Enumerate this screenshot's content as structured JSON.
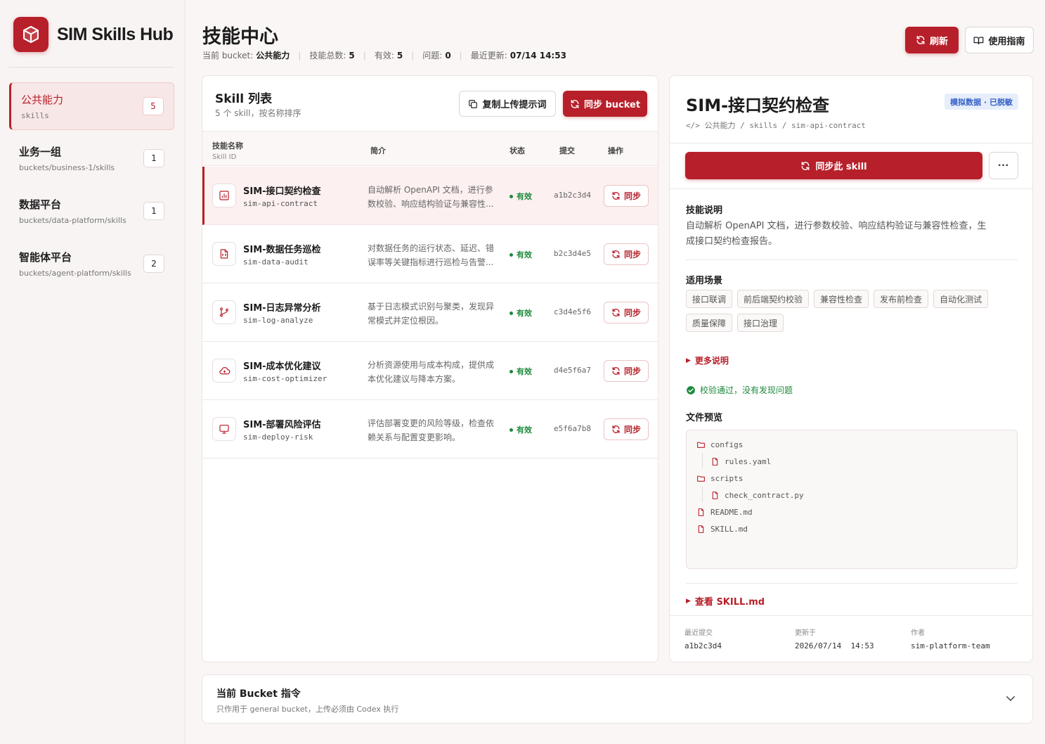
{
  "brand": {
    "name": "SIM Skills Hub"
  },
  "sidebar": {
    "buckets": [
      {
        "name": "公共能力",
        "path": "skills",
        "count": "5",
        "active": true
      },
      {
        "name": "业务一组",
        "path": "buckets/business-1/skills",
        "count": "1",
        "active": false
      },
      {
        "name": "数据平台",
        "path": "buckets/data-platform/skills",
        "count": "1",
        "active": false
      },
      {
        "name": "智能体平台",
        "path": "buckets/agent-platform/skills",
        "count": "2",
        "active": false
      }
    ]
  },
  "header": {
    "title": "技能中心",
    "stats": {
      "bucket_label": "当前 bucket:",
      "bucket_value": "公共能力",
      "total_label": "技能总数:",
      "total_value": "5",
      "valid_label": "有效:",
      "valid_value": "5",
      "issues_label": "问题:",
      "issues_value": "0",
      "updated_label": "最近更新:",
      "updated_value": "07/14 14:53"
    },
    "refresh_label": "刷新",
    "guide_label": "使用指南"
  },
  "list": {
    "title": "Skill 列表",
    "subtitle": "5 个 skill，按名称排序",
    "copy_label": "复制上传提示词",
    "sync_bucket_label": "同步 bucket",
    "columns": {
      "name": "技能名称",
      "name_sub": "Skill ID",
      "desc": "简介",
      "status": "状态",
      "commit": "提交",
      "action": "操作"
    },
    "rows": [
      {
        "name": "SIM-接口契约检查",
        "id": "sim-api-contract",
        "desc": "自动解析 OpenAPI 文档，进行参数校验、响应结构验证与兼容性...",
        "status": "有效",
        "commit": "a1b2c3d4",
        "sync": "同步",
        "icon": "chart-icon",
        "active": true
      },
      {
        "name": "SIM-数据任务巡检",
        "id": "sim-data-audit",
        "desc": "对数据任务的运行状态、延迟、错误率等关键指标进行巡检与告警...",
        "status": "有效",
        "commit": "b2c3d4e5",
        "sync": "同步",
        "icon": "file-code-icon",
        "active": false
      },
      {
        "name": "SIM-日志异常分析",
        "id": "sim-log-analyze",
        "desc": "基于日志模式识别与聚类，发现异常模式并定位根因。",
        "status": "有效",
        "commit": "c3d4e5f6",
        "sync": "同步",
        "icon": "git-branch-icon",
        "active": false
      },
      {
        "name": "SIM-成本优化建议",
        "id": "sim-cost-optimizer",
        "desc": "分析资源使用与成本构成，提供成本优化建议与降本方案。",
        "status": "有效",
        "commit": "d4e5f6a7",
        "sync": "同步",
        "icon": "cloud-icon",
        "active": false
      },
      {
        "name": "SIM-部署风险评估",
        "id": "sim-deploy-risk",
        "desc": "评估部署变更的风险等级，检查依赖关系与配置变更影响。",
        "status": "有效",
        "commit": "e5f6a7b8",
        "sync": "同步",
        "icon": "monitor-icon",
        "active": false
      }
    ]
  },
  "detail": {
    "title": "SIM-接口契约检查",
    "badge": "模拟数据 · 已脱敏",
    "breadcrumb": "公共能力 / skills / sim-api-contract",
    "sync_label": "同步此 skill",
    "more_label": "···",
    "desc_title": "技能说明",
    "desc": "自动解析 OpenAPI 文档，进行参数校验、响应结构验证与兼容性检查，生成接口契约检查报告。",
    "scenes_title": "适用场景",
    "tags": [
      "接口联调",
      "前后端契约校验",
      "兼容性检查",
      "发布前检查",
      "自动化测试",
      "质量保障",
      "接口治理"
    ],
    "more_desc_label": "更多说明",
    "valid_text": "校验通过，没有发现问题",
    "preview_title": "文件预览",
    "files": [
      "configs",
      "rules.yaml",
      "scripts",
      "check_contract.py",
      "README.md",
      "SKILL.md"
    ],
    "view_skill_label": "查看 SKILL.md",
    "meta": {
      "commit_label": "最近提交",
      "commit_value": "a1b2c3d4",
      "updated_label": "更新于",
      "updated_value": "2026/07/14  14:53",
      "author_label": "作者",
      "author_value": "sim-platform-team"
    }
  },
  "bottom": {
    "title": "当前 Bucket 指令",
    "subtitle": "只作用于 general bucket，上传必须由 Codex 执行"
  },
  "colors": {
    "accent": "#b7202a",
    "success": "#1e8a3c",
    "badge": "#3561c8"
  }
}
